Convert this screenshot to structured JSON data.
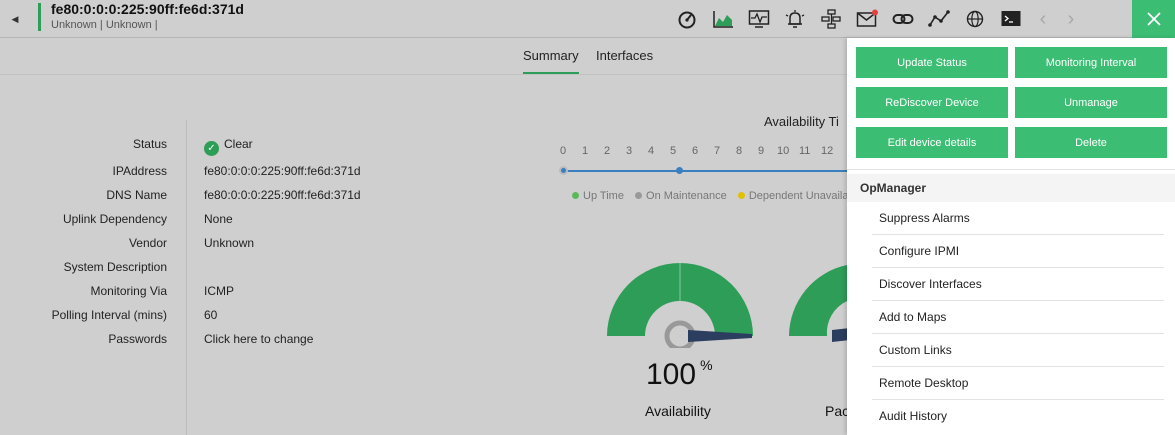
{
  "header": {
    "back_icon": "caret-left-icon",
    "device_name": "fe80:0:0:0:225:90ff:fe6d:371d",
    "device_subtitle": "Unknown | Unknown  |",
    "toolbar_icons": [
      "dashboard-icon",
      "area-chart-icon",
      "performance-monitor-icon",
      "alarm-bell-icon",
      "network-topology-icon",
      "mail-icon",
      "link-icon",
      "trend-line-icon",
      "globe-icon",
      "terminal-icon"
    ],
    "close_icon": "close-icon"
  },
  "tabs": [
    {
      "label": "Summary",
      "active": true
    },
    {
      "label": "Interfaces",
      "active": false
    }
  ],
  "details": [
    {
      "label": "Status",
      "value": "Clear"
    },
    {
      "label": "IPAddress",
      "value": "fe80:0:0:0:225:90ff:fe6d:371d"
    },
    {
      "label": "DNS Name",
      "value": "fe80:0:0:0:225:90ff:fe6d:371d"
    },
    {
      "label": "Uplink Dependency",
      "value": "None"
    },
    {
      "label": "Vendor",
      "value": "Unknown"
    },
    {
      "label": "System Description",
      "value": ""
    },
    {
      "label": "Monitoring Via",
      "value": "ICMP"
    },
    {
      "label": "Polling Interval (mins)",
      "value": "60"
    },
    {
      "label": "Passwords",
      "value": "Click here to change"
    }
  ],
  "availability": {
    "title": "Availability Ti",
    "hours": [
      "0",
      "1",
      "2",
      "3",
      "4",
      "5",
      "6",
      "7",
      "8",
      "9",
      "10",
      "11",
      "12"
    ],
    "legend": [
      "Up Time",
      "On Maintenance",
      "Dependent Unavailab"
    ],
    "legend_colors": [
      "#5cb85c",
      "#999999",
      "#e0c000"
    ]
  },
  "gauges": {
    "availability_value": "100",
    "availability_unit": "%",
    "availability_label": "Availability",
    "second_label": "Pac",
    "gauge_color": "#2e9d57"
  },
  "actions": {
    "update_status": "Update Status",
    "monitoring_interval": "Monitoring Interval",
    "rediscover_device": "ReDiscover Device",
    "unmanage": "Unmanage",
    "edit_device_details": "Edit device details",
    "delete": "Delete"
  },
  "menu": {
    "header": "OpManager",
    "items": [
      "Suppress Alarms",
      "Configure IPMI",
      "Discover Interfaces",
      "Add to Maps",
      "Custom Links",
      "Remote Desktop",
      "Audit History"
    ]
  },
  "colors": {
    "accent": "#3cbd74",
    "brand_green": "#2e9d57",
    "timeline": "#3a7fc0"
  }
}
